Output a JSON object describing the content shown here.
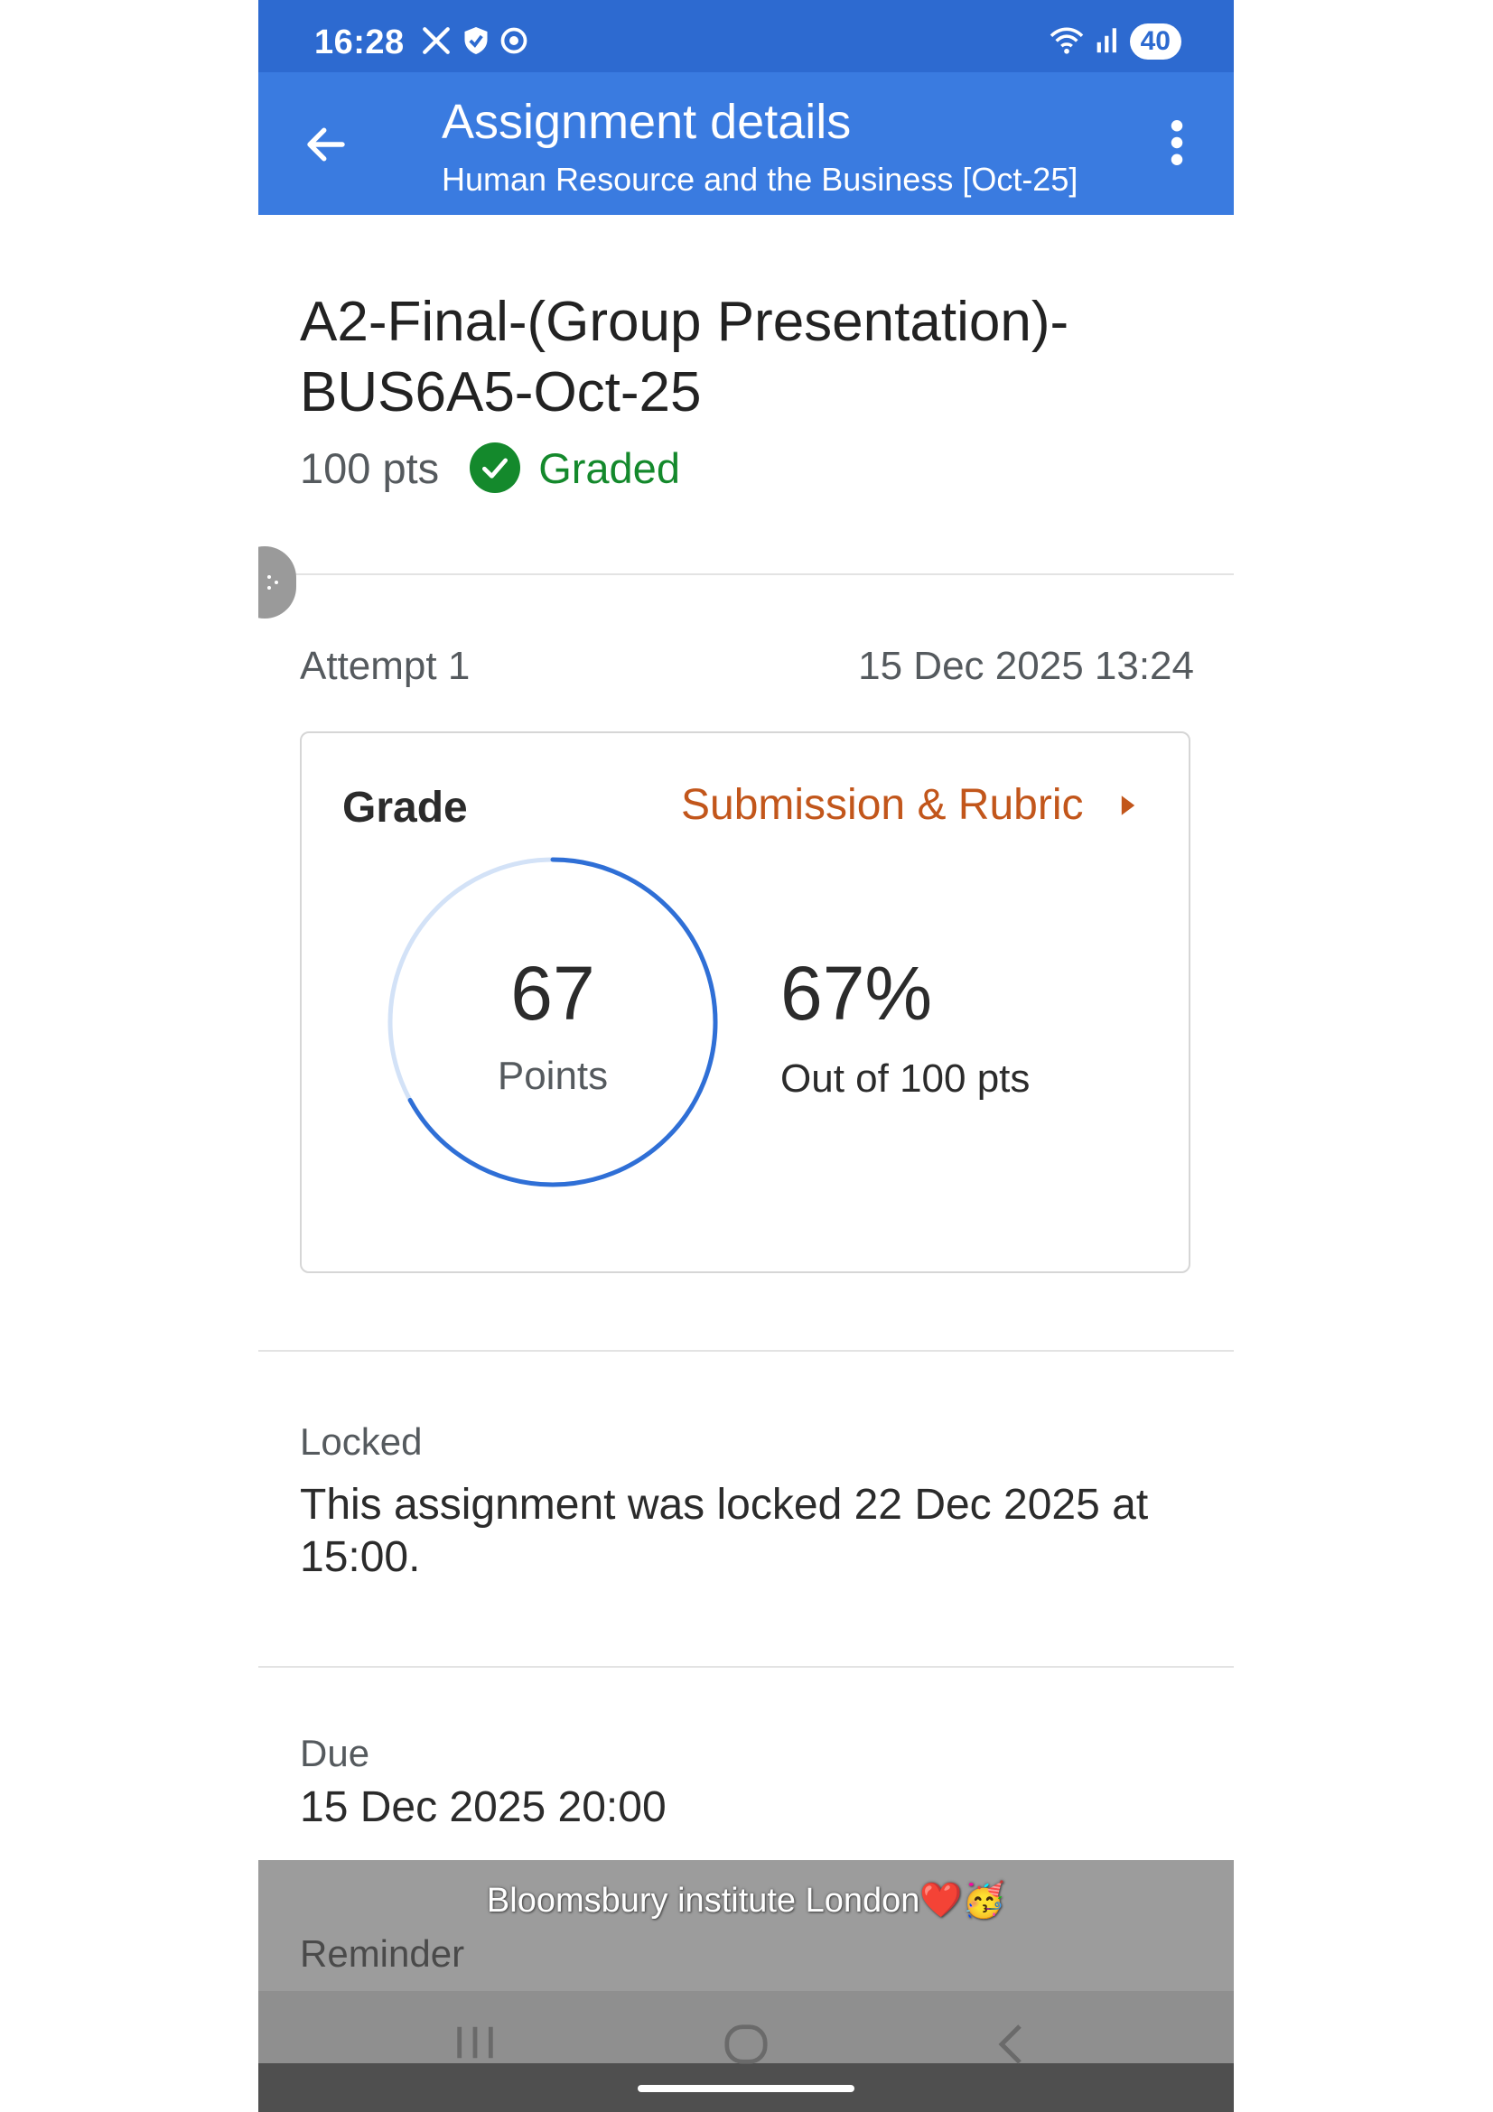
{
  "status_bar": {
    "time": "16:28",
    "battery": "40",
    "icons": [
      "x-logo-icon",
      "shield-icon",
      "chrome-icon",
      "wifi-icon",
      "signal-icon"
    ]
  },
  "app_bar": {
    "title": "Assignment details",
    "subtitle": "Human Resource and the Business [Oct-25]",
    "color": "#3a7be0"
  },
  "assignment": {
    "title": "A2-Final-(Group Presentation)-BUS6A5-Oct-25",
    "points": "100 pts",
    "status": "Graded",
    "status_color": "#14892c"
  },
  "attempt": {
    "label": "Attempt 1",
    "date": "15 Dec 2025 13:24"
  },
  "grade_card": {
    "label": "Grade",
    "link_label": "Submission & Rubric",
    "link_color": "#c2561b",
    "points_value": "67",
    "points_label": "Points",
    "percent": "67%",
    "out_of": "Out of 100 pts",
    "progress_fraction": 0.67
  },
  "locked": {
    "label": "Locked",
    "text": "This assignment was locked 22 Dec 2025 at 15:00."
  },
  "due": {
    "label": "Due",
    "text": "15 Dec 2025 20:00"
  },
  "reminder": {
    "label": "Reminder"
  },
  "overlay_caption": "Bloomsbury institute London❤️🥳"
}
